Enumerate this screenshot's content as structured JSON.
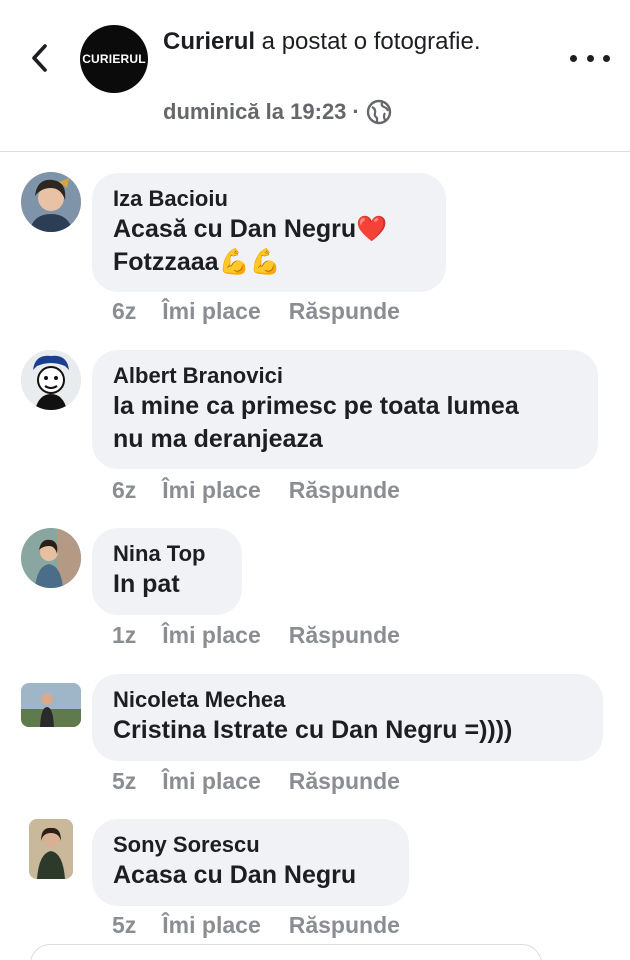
{
  "post": {
    "page_name": "Curierul",
    "action_text": " a postat o fotografie.",
    "logo_text": "CURIERUL",
    "timestamp": "duminică la 19:23",
    "separator": "·",
    "privacy_icon": "globe-icon"
  },
  "comments": [
    {
      "name": "Iza Bacioiu",
      "text": "Acasă cu Dan Negru",
      "emoji_line1": "❤️",
      "line2": "Fotzzaaa",
      "emoji_line2": "💪💪",
      "time": "6z",
      "like": "Îmi place",
      "reply": "Răspunde"
    },
    {
      "name": "Albert Branovici",
      "text": "la mine ca primesc pe toata lumea\nnu ma deranjeaza",
      "time": "6z",
      "like": "Îmi place",
      "reply": "Răspunde"
    },
    {
      "name": "Nina Top",
      "text": "In pat",
      "time": "1z",
      "like": "Îmi place",
      "reply": "Răspunde"
    },
    {
      "name": "Nicoleta Mechea",
      "text": "Cristina Istrate cu Dan Negru =))))",
      "time": "5z",
      "like": "Îmi place",
      "reply": "Răspunde"
    },
    {
      "name": "Sony Sorescu",
      "text": "Acasa cu Dan Negru",
      "time": "5z",
      "like": "Îmi place",
      "reply": "Răspunde"
    }
  ],
  "colors": {
    "bubble": "#f0f2f5",
    "meta": "#65676b",
    "actions": "#8a8d91",
    "heart": "#e0245e"
  }
}
